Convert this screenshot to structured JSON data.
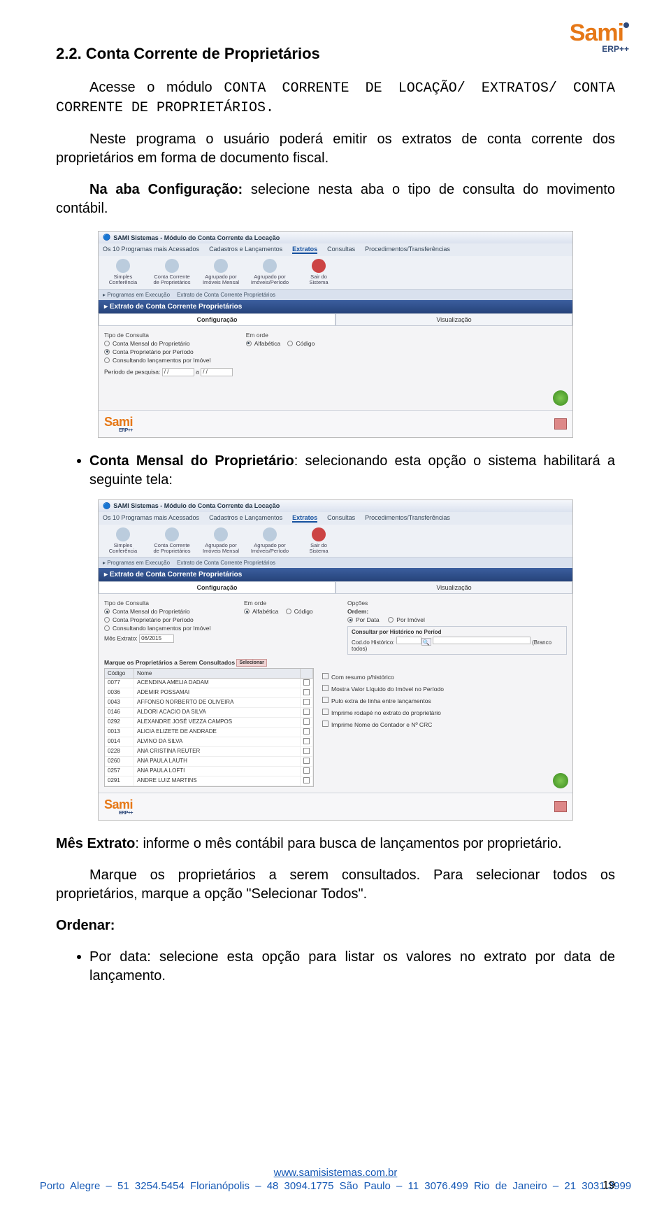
{
  "logo": {
    "brand": "Sami",
    "sub": "ERP++"
  },
  "heading": "2.2. Conta Corrente de Proprietários",
  "intro": "Acesse o módulo ",
  "introMono": "CONTA CORRENTE DE LOCAÇÃO/ EXTRATOS/ CONTA CORRENTE DE PROPRIETÁRIOS.",
  "para2": "Neste programa o usuário poderá emitir os extratos de conta corrente dos proprietários em forma de documento fiscal.",
  "para3_pre": "Na aba Configuração:",
  "para3_rest": " selecione nesta aba o tipo de consulta do movimento contábil.",
  "shot1": {
    "title": "SAMI Sistemas - Módulo do Conta Corrente da Locação",
    "menus": [
      "Os 10 Programas mais Acessados",
      "Cadastros e Lançamentos",
      "Extratos",
      "Consultas",
      "Procedimentos/Transferências"
    ],
    "toolbar": [
      {
        "l1": "Simples",
        "l2": "Conferência"
      },
      {
        "l1": "Conta Corrente",
        "l2": "de Proprietários"
      },
      {
        "l1": "Agrupado por",
        "l2": "Imóveis Mensal"
      },
      {
        "l1": "Agrupado por",
        "l2": "Imóveis/Período"
      },
      {
        "l1": "Sair do",
        "l2": "Sistema"
      }
    ],
    "tabs": [
      "Programas em Execução",
      "Extrato de Conta Corrente Proprietários"
    ],
    "panel": "Extrato de Conta Corrente Proprietários",
    "subtabs": [
      "Configuração",
      "Visualização"
    ],
    "tipoConsultaLabel": "Tipo de Consulta",
    "consultOptions": [
      "Conta Mensal do Proprietário",
      "Conta Proprietário por Período",
      "Consultando lançamentos por Imóvel"
    ],
    "emOrde": "Em orde",
    "ordeOptions": [
      "Alfabética",
      "Código"
    ],
    "periodoLabel": "Período de pesquisa:",
    "periodoTo": "a",
    "dateVal": "/ /"
  },
  "bullet1_pre": "Conta Mensal do Proprietário",
  "bullet1_rest": ": selecionando esta opção o sistema habilitará a seguinte tela:",
  "shot2": {
    "opcoesLabel": "Opções",
    "ordemLabel": "Ordem:",
    "ordemOptions": [
      "Por Data",
      "Por Imóvel"
    ],
    "histTitle": "Consultar por Histórico no Períod",
    "histLabel": "Cod.do Histórico:",
    "histBlank": "(Branco todos)",
    "mesLabel": "Mês Extrato:",
    "mesVal": "06/2015",
    "marqueLabel": "Marque os Proprietários a Serem Consultados",
    "selBtn": "Selecionar",
    "tableHdr": {
      "code": "Código",
      "name": "Nome"
    },
    "rows": [
      {
        "c": "0077",
        "n": "ACENDINA AMELIA DADAM"
      },
      {
        "c": "0036",
        "n": "ADEMIR POSSAMAI"
      },
      {
        "c": "0043",
        "n": "AFFONSO NORBERTO DE OLIVEIRA"
      },
      {
        "c": "0146",
        "n": "ALDORI ACACIO DA SILVA"
      },
      {
        "c": "0292",
        "n": "ALEXANDRE JOSÉ VEZZA CAMPOS"
      },
      {
        "c": "0013",
        "n": "ALICIA ELIZETE DE ANDRADE"
      },
      {
        "c": "0014",
        "n": "ALVINO DA SILVA"
      },
      {
        "c": "0228",
        "n": "ANA CRISTINA REUTER"
      },
      {
        "c": "0260",
        "n": "ANA PAULA LAUTH"
      },
      {
        "c": "0257",
        "n": "ANA PAULA LOFTI"
      },
      {
        "c": "0291",
        "n": "ANDRE LUIZ MARTINS"
      }
    ],
    "checks": [
      "Com resumo p/histórico",
      "Mostra Valor Líquido do Imóvel no Período",
      "Pulo extra de linha entre lançamentos",
      "Imprime rodapé no extrato do proprietário",
      "Imprime Nome do Contador e Nº CRC"
    ]
  },
  "mesExtrato_pre": "Mês Extrato",
  "mesExtrato_rest": ": informe o mês contábil para busca de lançamentos por proprietário.",
  "marque": "Marque os proprietários a serem consultados. Para selecionar todos os proprietários, marque a opção \"Selecionar Todos\".",
  "ordenar": "Ordenar:",
  "bullet2": "Por data: selecione esta opção para listar os valores no extrato por data de lançamento.",
  "footer": {
    "url": "www.samisistemas.com.br",
    "contacts": "Porto Alegre – 51 3254.5454      Florianópolis – 48 3094.1775      São Paulo – 11 3076.499      Rio de Janeiro – 21 3031.3999"
  },
  "pageNum": "19"
}
